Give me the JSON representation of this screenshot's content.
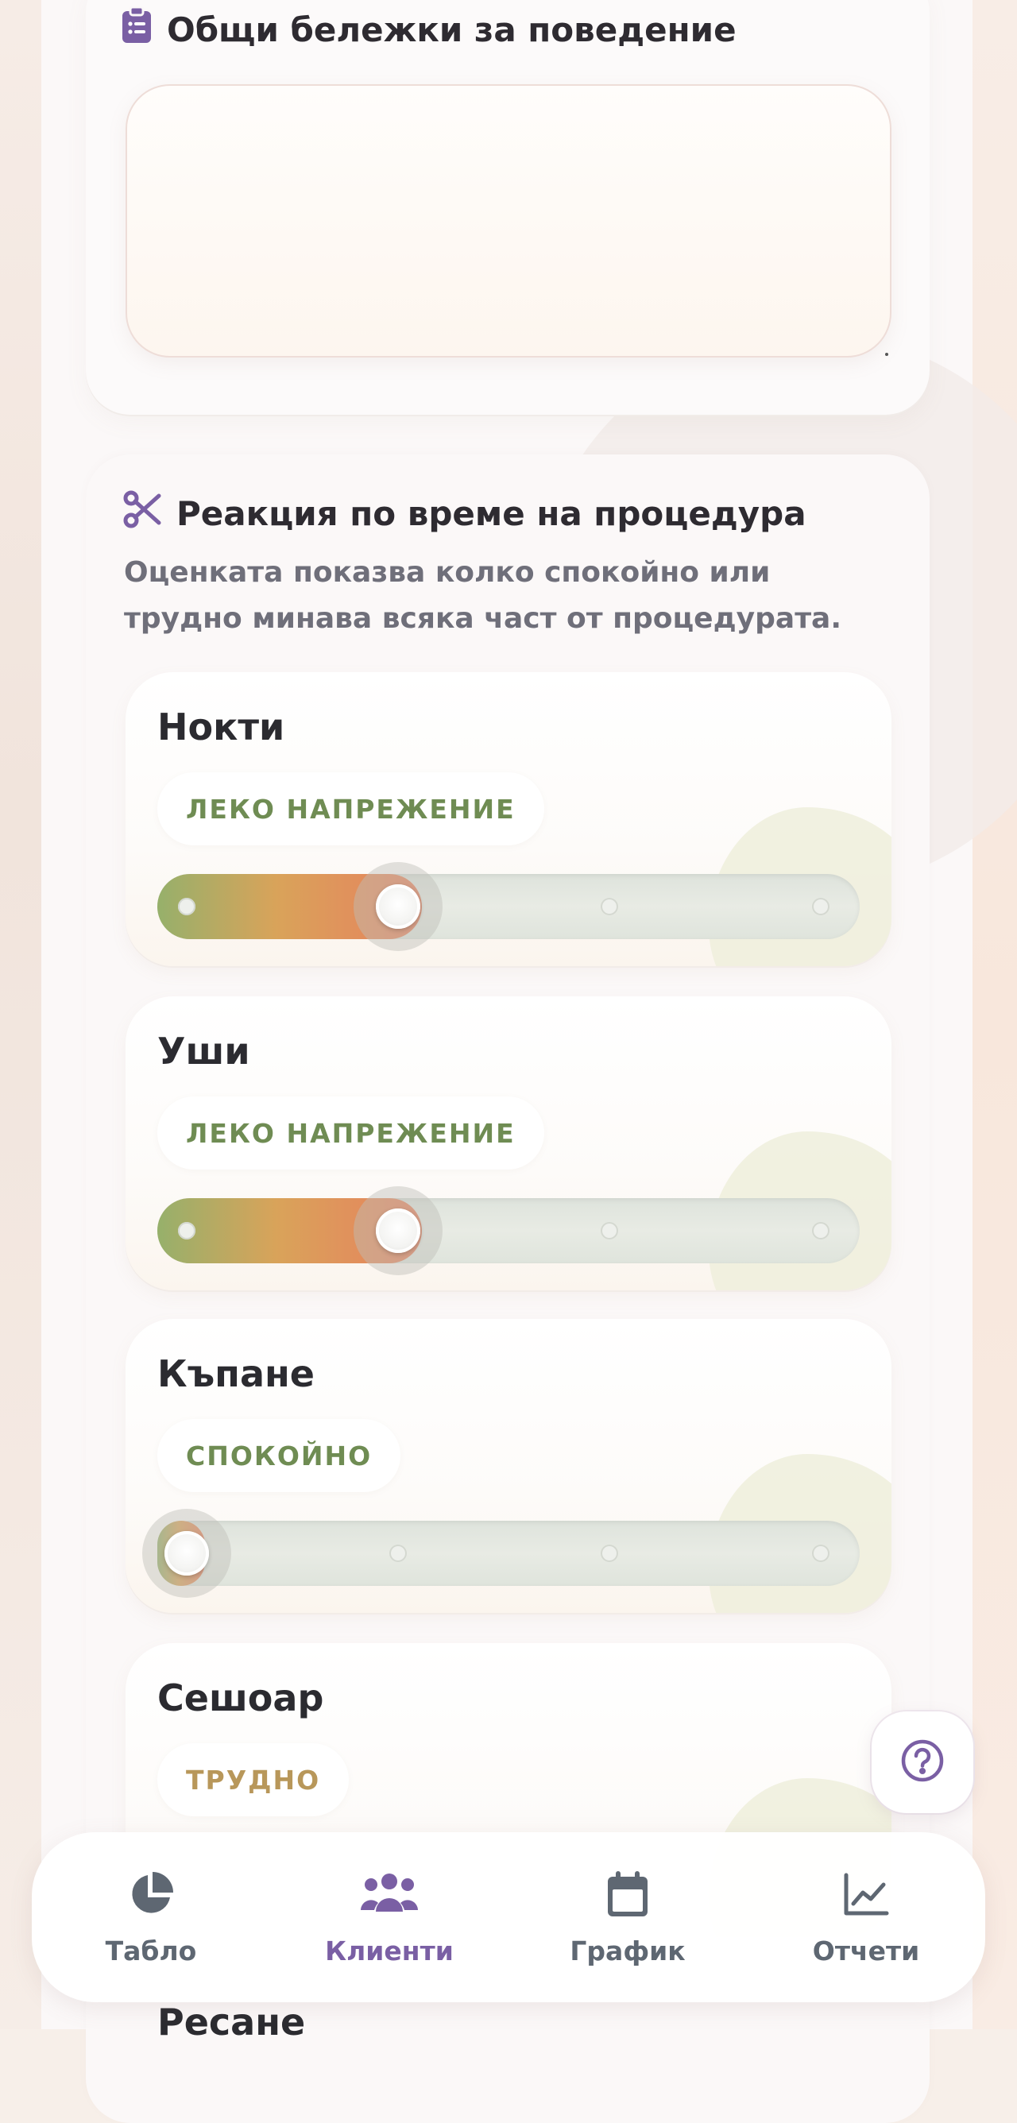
{
  "notes": {
    "title": "Общи бележки за поведение",
    "icon": "clipboard-list-icon",
    "value": ""
  },
  "reaction": {
    "title": "Реакция по време на процедура",
    "icon": "scissors-icon",
    "subtitle": "Оценката показва колко спокойно или трудно минава всяка част от процедурата.",
    "items": [
      {
        "name": "Нокти",
        "level": "ЛЕКО НАПРЕЖЕНИЕ",
        "step": 1,
        "steps": 4
      },
      {
        "name": "Уши",
        "level": "ЛЕКО НАПРЕЖЕНИЕ",
        "step": 1,
        "steps": 4
      },
      {
        "name": "Къпане",
        "level": "СПОКОЙНО",
        "step": 0,
        "steps": 4
      },
      {
        "name": "Сешоар",
        "level": "ТРУДНО",
        "step": 2,
        "steps": 4
      },
      {
        "name": "Ресане"
      }
    ]
  },
  "help": {
    "icon": "question-circle-icon"
  },
  "nav": [
    {
      "label": "Табло",
      "icon": "pie-chart-icon",
      "active": false
    },
    {
      "label": "Клиенти",
      "icon": "users-icon",
      "active": true
    },
    {
      "label": "График",
      "icon": "calendar-icon",
      "active": false
    },
    {
      "label": "Отчети",
      "icon": "line-chart-icon",
      "active": false
    }
  ],
  "colors": {
    "accent": "#7a5fa4",
    "calm": "#6f8c53",
    "hard": "#b8975a"
  }
}
